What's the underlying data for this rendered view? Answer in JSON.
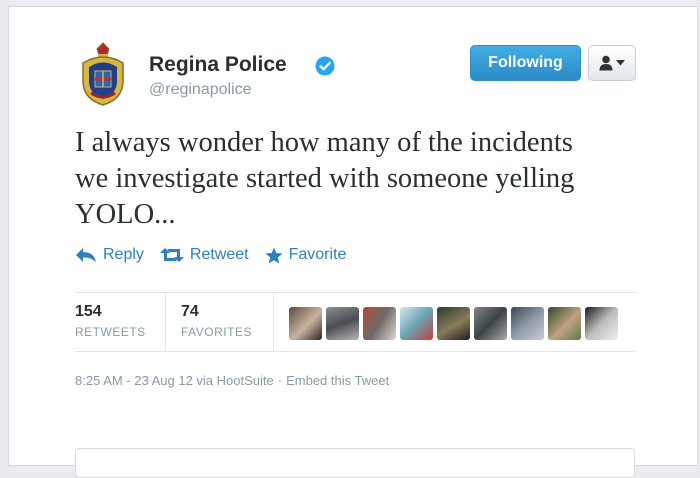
{
  "author": {
    "name": "Regina Police",
    "handle": "@reginapolice"
  },
  "follow_button": {
    "label": "Following"
  },
  "tweet": {
    "text_lines": [
      "I always wonder how many of the incidents",
      "we investigate started with someone yelling",
      "YOLO..."
    ]
  },
  "actions": {
    "reply": "Reply",
    "retweet": "Retweet",
    "favorite": "Favorite"
  },
  "stats": {
    "retweets": {
      "value": "154",
      "label": "RETWEETS"
    },
    "favorites": {
      "value": "74",
      "label": "FAVORITES"
    }
  },
  "meta": {
    "timestamp": "8:25 AM - 23 Aug 12 via HootSuite",
    "separator": "·",
    "embed": "Embed this Tweet"
  },
  "colors": {
    "accent": "#2f7fc1",
    "follow_button": "#2c8ac6",
    "verified": "#2aa3ef"
  }
}
